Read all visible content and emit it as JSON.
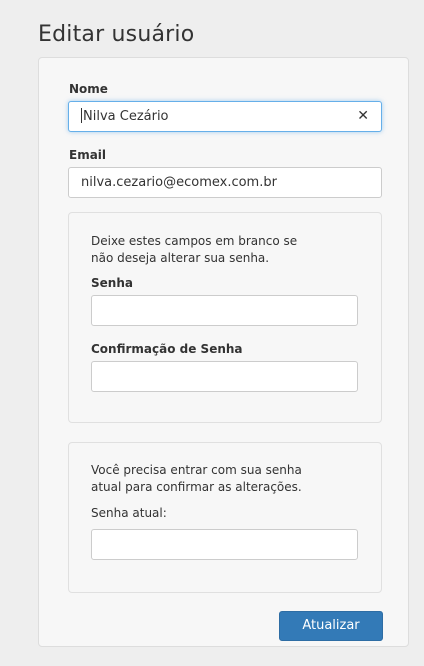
{
  "page": {
    "title": "Editar usuário"
  },
  "form": {
    "nome_label": "Nome",
    "nome_value": "Nilva Cezário",
    "email_label": "Email",
    "email_value": "nilva.cezario@ecomex.com.br",
    "password_section": {
      "help_line1": "Deixe estes campos em branco se",
      "help_line2": "não deseja alterar sua senha.",
      "senha_label": "Senha",
      "senha_value": "",
      "confirmacao_label": "Confirmação de Senha",
      "confirmacao_value": ""
    },
    "current_password_section": {
      "help_line1": "Você precisa entrar com sua senha",
      "help_line2": "atual para confirmar as alterações.",
      "senha_atual_label": "Senha atual:",
      "senha_atual_value": ""
    },
    "submit_label": "Atualizar"
  },
  "icons": {
    "clear": "close-icon"
  },
  "colors": {
    "primary": "#337ab7",
    "focus_border": "#66afe9"
  }
}
